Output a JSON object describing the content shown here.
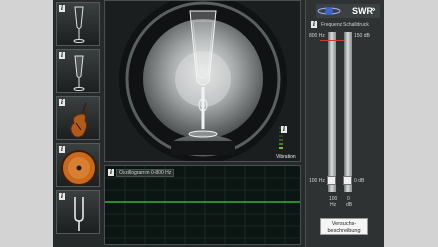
{
  "thumbnails": [
    {
      "icon": "champagne-glass-icon"
    },
    {
      "icon": "champagne-glass-icon"
    },
    {
      "icon": "violin-icon"
    },
    {
      "icon": "speaker-drum-icon"
    },
    {
      "icon": "tuning-fork-icon"
    }
  ],
  "info_glyph": "i",
  "stage": {
    "label": "Vibration"
  },
  "oscilloscope": {
    "title": "Oszillogramm 0-800 Hz"
  },
  "sidebar": {
    "logo": "SWR",
    "col_frequenz": "Frequenz",
    "col_schalldruck": "Schalldruck",
    "freq_top": "800 Hz",
    "freq_bottom": "100 Hz",
    "db_top": "150 dB",
    "db_bottom": "0 dB",
    "freq_value_line1": "100",
    "freq_value_line2": "Hz",
    "db_value_line1": "0",
    "db_value_line2": "dB",
    "button_line1": "Versuchs-",
    "button_line2": "beschreibung"
  },
  "colors": {
    "accent": "#d43a2f",
    "wave": "#2ddc3d",
    "vu_on": "#6bbf3a"
  }
}
